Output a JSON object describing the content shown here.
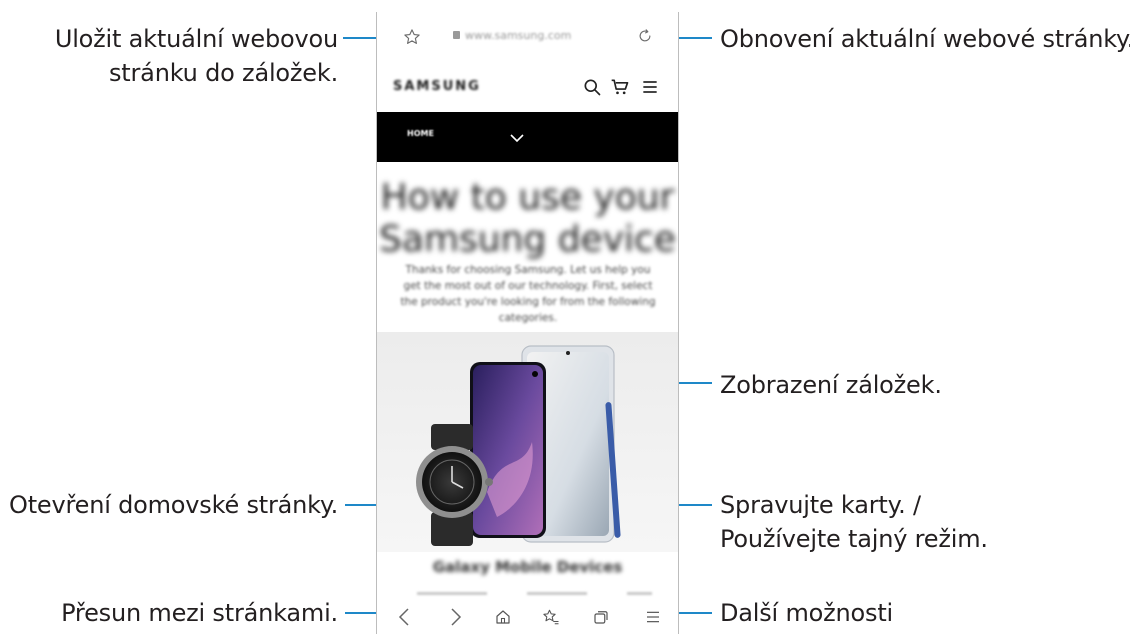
{
  "browser": {
    "url": "www.samsung.com",
    "site_logo": "SAMSUNG",
    "nav_home": "HOME",
    "hero_title_line1": "How to use your",
    "hero_title_line2": "Samsung device",
    "hero_subtitle": "Thanks for choosing Samsung. Let us help you get the most out of our technology. First, select the product you're looking for from the following categories.",
    "section_title": "Galaxy Mobile Devices"
  },
  "callouts": {
    "bookmark_line1": "Uložit aktuální webovou",
    "bookmark_line2": "stránku do záložek.",
    "refresh": "Obnovení aktuální webové stránky.",
    "view_bookmarks": "Zobrazení záložek.",
    "home": "Otevření domovské stránky.",
    "tabs_line1": "Spravujte karty. /",
    "tabs_line2": "Používejte tajný režim.",
    "navigate": "Přesun mezi stránkami.",
    "more": "Další možnosti"
  },
  "colors": {
    "leader": "#1e88c8",
    "text": "#231f20",
    "icon": "#555555"
  },
  "icons": [
    "star-outline-icon",
    "lock-icon",
    "refresh-icon",
    "search-icon",
    "cart-icon",
    "menu-icon",
    "chevron-down-icon",
    "back-icon",
    "forward-icon",
    "home-icon",
    "bookmarks-icon",
    "tabs-icon",
    "more-options-icon"
  ]
}
